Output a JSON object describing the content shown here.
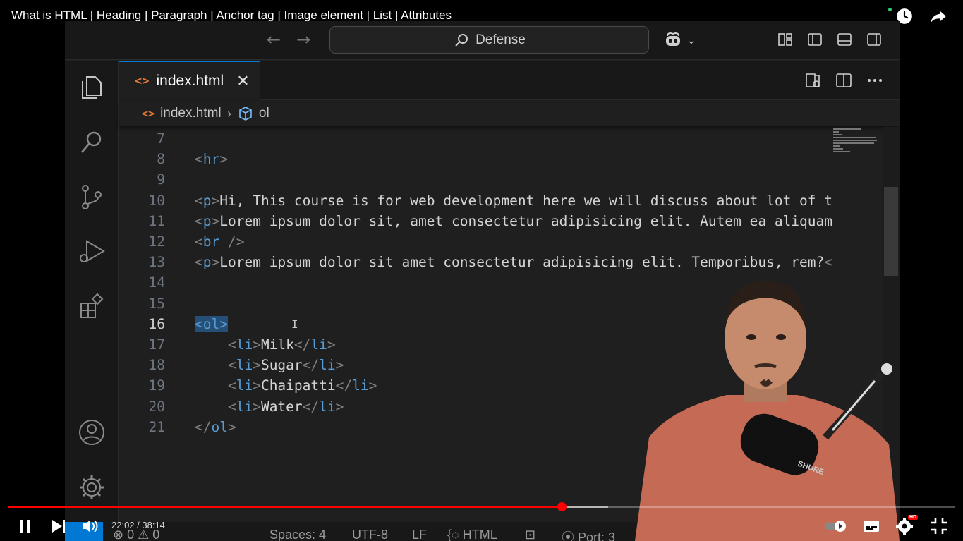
{
  "video": {
    "title": "What is HTML | Heading | Paragraph | Anchor tag | Image element | List | Attributes",
    "time": "22:02 / 38:14",
    "progress": 0.585,
    "buffered": 0.634,
    "quality_badge": "HD"
  },
  "vscode": {
    "search_text": "Defense",
    "tab": {
      "label": "index.html",
      "icon": "<>"
    },
    "breadcrumb": {
      "file": "index.html",
      "symbol": "ol",
      "file_icon": "<>"
    },
    "status": {
      "problems": "0",
      "warnings": "0",
      "spaces": "Spaces: 4",
      "encoding": "UTF-8",
      "eol": "LF",
      "language": "HTML",
      "port": "Port: 3"
    },
    "current_line": 16
  },
  "code_lines": [
    {
      "num": "7",
      "parts": []
    },
    {
      "num": "8",
      "parts": [
        [
          "br",
          "<"
        ],
        [
          "tag",
          "hr"
        ],
        [
          "br",
          ">"
        ]
      ]
    },
    {
      "num": "9",
      "parts": []
    },
    {
      "num": "10",
      "parts": [
        [
          "br",
          "<"
        ],
        [
          "tag",
          "p"
        ],
        [
          "br",
          ">"
        ],
        [
          "txt",
          "Hi, This course is for web development here we will discuss about lot of t"
        ]
      ]
    },
    {
      "num": "11",
      "parts": [
        [
          "br",
          "<"
        ],
        [
          "tag",
          "p"
        ],
        [
          "br",
          ">"
        ],
        [
          "txt",
          "Lorem ipsum dolor sit, amet consectetur adipisicing elit. Autem ea aliquam"
        ]
      ]
    },
    {
      "num": "12",
      "parts": [
        [
          "br",
          "<"
        ],
        [
          "tag",
          "br"
        ],
        [
          "txt",
          " "
        ],
        [
          "br",
          "/>"
        ]
      ]
    },
    {
      "num": "13",
      "parts": [
        [
          "br",
          "<"
        ],
        [
          "tag",
          "p"
        ],
        [
          "br",
          ">"
        ],
        [
          "txt",
          "Lorem ipsum dolor sit amet consectetur adipisicing elit. Temporibus, rem?"
        ],
        [
          "br",
          "<"
        ]
      ]
    },
    {
      "num": "14",
      "parts": []
    },
    {
      "num": "15",
      "parts": []
    },
    {
      "num": "16",
      "parts": [
        [
          "sel",
          "<ol>"
        ]
      ]
    },
    {
      "num": "17",
      "parts": [
        [
          "txt",
          "    "
        ],
        [
          "br",
          "<"
        ],
        [
          "tag",
          "li"
        ],
        [
          "br",
          ">"
        ],
        [
          "txt",
          "Milk"
        ],
        [
          "br",
          "</"
        ],
        [
          "tag",
          "li"
        ],
        [
          "br",
          ">"
        ]
      ]
    },
    {
      "num": "18",
      "parts": [
        [
          "txt",
          "    "
        ],
        [
          "br",
          "<"
        ],
        [
          "tag",
          "li"
        ],
        [
          "br",
          ">"
        ],
        [
          "txt",
          "Sugar"
        ],
        [
          "br",
          "</"
        ],
        [
          "tag",
          "li"
        ],
        [
          "br",
          ">"
        ]
      ]
    },
    {
      "num": "19",
      "parts": [
        [
          "txt",
          "    "
        ],
        [
          "br",
          "<"
        ],
        [
          "tag",
          "li"
        ],
        [
          "br",
          ">"
        ],
        [
          "txt",
          "Chaipatti"
        ],
        [
          "br",
          "</"
        ],
        [
          "tag",
          "li"
        ],
        [
          "br",
          ">"
        ]
      ]
    },
    {
      "num": "20",
      "parts": [
        [
          "txt",
          "    "
        ],
        [
          "br",
          "<"
        ],
        [
          "tag",
          "li"
        ],
        [
          "br",
          ">"
        ],
        [
          "txt",
          "Water"
        ],
        [
          "br",
          "</"
        ],
        [
          "tag",
          "li"
        ],
        [
          "br",
          ">"
        ]
      ]
    },
    {
      "num": "21",
      "parts": [
        [
          "br",
          "</"
        ],
        [
          "tag",
          "ol"
        ],
        [
          "br",
          ">"
        ]
      ]
    }
  ],
  "presenter": {
    "mic_brand": "SHURE"
  }
}
